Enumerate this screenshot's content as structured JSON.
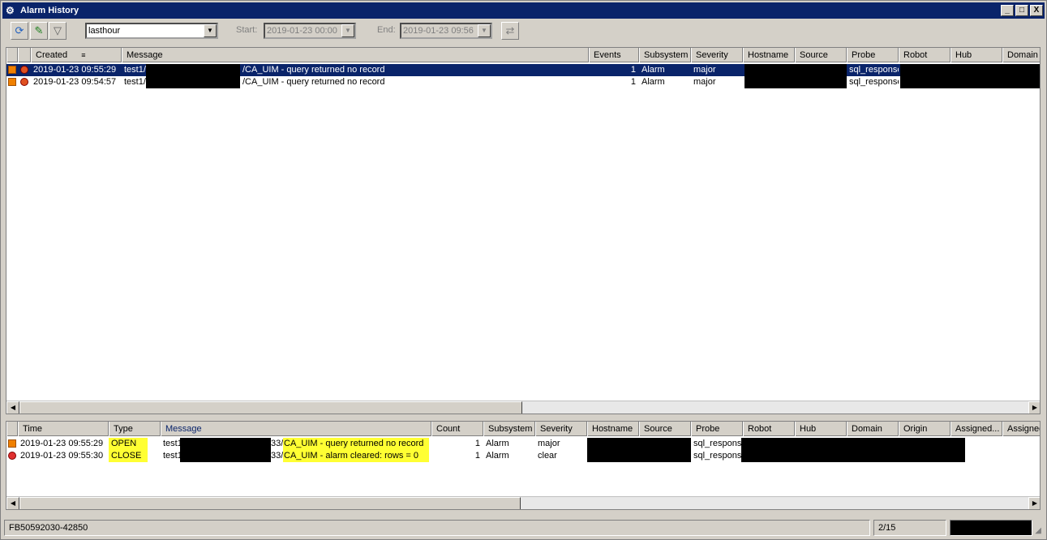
{
  "window": {
    "title": "Alarm History",
    "min": "_",
    "max": "□",
    "close": "X"
  },
  "toolbar": {
    "period_value": "lasthour",
    "start_label": "Start:",
    "start_value": "2019-01-23 00:00",
    "end_label": "End:",
    "end_value": "2019-01-23 09:56"
  },
  "upper": {
    "headers": [
      "Created",
      "Message",
      "Events",
      "Subsystem",
      "Severity",
      "Hostname",
      "Source",
      "Probe",
      "Robot",
      "Hub",
      "Domain"
    ],
    "rows": [
      {
        "created": "2019-01-23 09:55:29",
        "msg_prefix": "test1/",
        "msg_suffix": "/CA_UIM - query returned no record",
        "events": "1",
        "subsystem": "Alarm",
        "severity": "major",
        "probe": "sql_response"
      },
      {
        "created": "2019-01-23 09:54:57",
        "msg_prefix": "test1/",
        "msg_suffix": "/CA_UIM - query returned no record",
        "events": "1",
        "subsystem": "Alarm",
        "severity": "major",
        "probe": "sql_response"
      }
    ]
  },
  "lower": {
    "headers": [
      "Time",
      "Type",
      "Message",
      "Count",
      "Subsystem",
      "Severity",
      "Hostname",
      "Source",
      "Probe",
      "Robot",
      "Hub",
      "Domain",
      "Origin",
      "Assigned...",
      "Assigned"
    ],
    "rows": [
      {
        "time": "2019-01-23 09:55:29",
        "type": "OPEN",
        "msg_prefix": "test1",
        "msg_mid": "33/",
        "msg_suffix": "CA_UIM - query returned no record",
        "count": "1",
        "subsystem": "Alarm",
        "severity": "major",
        "probe": "sql_response"
      },
      {
        "time": "2019-01-23 09:55:30",
        "type": "CLOSE",
        "msg_prefix": "test1",
        "msg_mid": "33/",
        "msg_suffix": "CA_UIM - alarm cleared: rows = 0",
        "count": "1",
        "subsystem": "Alarm",
        "severity": "clear",
        "probe": "sql_response"
      }
    ]
  },
  "status": {
    "id": "FB50592030-42850",
    "page": "2/15"
  },
  "colors": {
    "title_bg": "#0a246a",
    "highlight": "#ffff33",
    "major": "#f08000",
    "clear": "#e03030"
  }
}
